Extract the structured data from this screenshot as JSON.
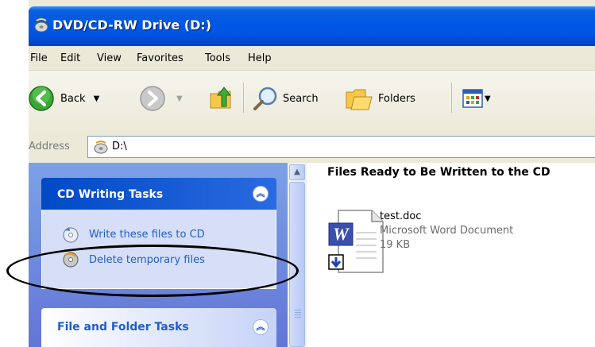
{
  "window": {
    "title": "DVD/CD-RW Drive (D:)"
  },
  "menu": {
    "items": [
      "File",
      "Edit",
      "View",
      "Favorites",
      "Tools",
      "Help"
    ]
  },
  "toolbar": {
    "back_label": "Back",
    "search_label": "Search",
    "folders_label": "Folders"
  },
  "address": {
    "label": "Address",
    "value": "D:\\"
  },
  "tasks": {
    "cd_writing": {
      "title": "CD Writing Tasks",
      "items": [
        "Write these files to CD",
        "Delete temporary files"
      ]
    },
    "file_folder": {
      "title": "File and Folder Tasks"
    }
  },
  "content": {
    "group_title": "Files Ready to Be Written to the CD",
    "file": {
      "name": "test.doc",
      "type": "Microsoft Word Document",
      "size": "19 KB"
    }
  },
  "colors": {
    "titlebar": "#0054e3",
    "link": "#215dc6",
    "taskpane": "#6f8fe0"
  }
}
